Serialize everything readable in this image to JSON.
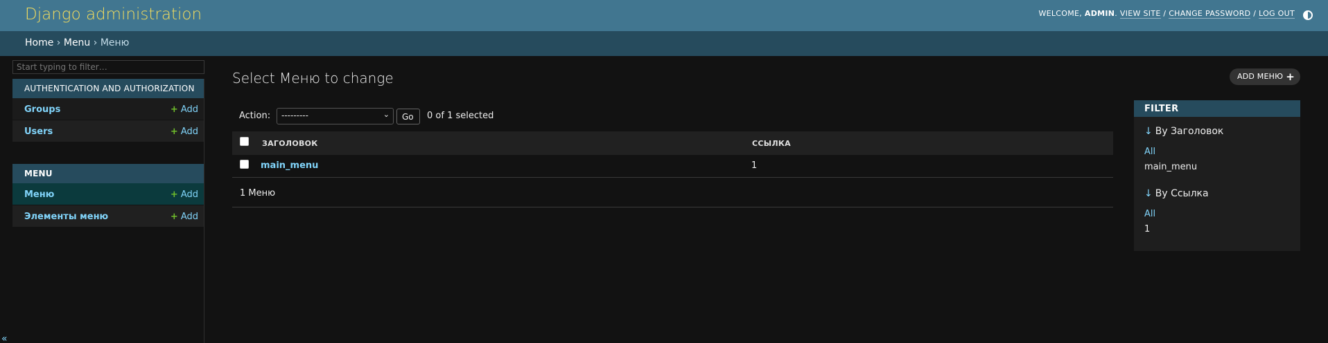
{
  "header": {
    "branding": "Django administration",
    "welcome": "Welcome,",
    "username": "admin",
    "view_site": "View site",
    "change_password": "Change password",
    "log_out": "Log out",
    "separator": "/"
  },
  "breadcrumbs": {
    "home": "Home",
    "app": "Menu",
    "model": "Меню",
    "sep": "›"
  },
  "sidebar": {
    "filter_placeholder": "Start typing to filter…",
    "modules": [
      {
        "caption": "Authentication and Authorization",
        "models": [
          {
            "name": "Groups",
            "add": "Add"
          },
          {
            "name": "Users",
            "add": "Add"
          }
        ]
      },
      {
        "caption": "Menu",
        "models": [
          {
            "name": "Меню",
            "add": "Add"
          },
          {
            "name": "Элементы меню",
            "add": "Add"
          }
        ]
      }
    ],
    "collapse": "«"
  },
  "content": {
    "title": "Select Меню to change",
    "add_button": "ADD МЕНЮ",
    "action_label": "Action:",
    "action_selected": "---------",
    "go_button": "Go",
    "action_counter": "0 of 1 selected",
    "columns": [
      "ЗАГОЛОВОК",
      "ССЫЛКА"
    ],
    "rows": [
      {
        "title": "main_menu",
        "link": "1"
      }
    ],
    "paginator": "1 Меню"
  },
  "filter": {
    "header": "FILTER",
    "groups": [
      {
        "title": "By Заголовок",
        "choices": [
          "All",
          "main_menu"
        ]
      },
      {
        "title": "By Ссылка",
        "choices": [
          "All",
          "1"
        ]
      }
    ]
  },
  "colors": {
    "header_bg": "#417690",
    "breadcrumb_bg": "#264b5d",
    "branding": "#f5dd5d",
    "link": "#81d4fa",
    "add_green": "#70bf2b",
    "body_bg": "#121212"
  },
  "icons": [
    "theme-toggle-icon",
    "plus-icon",
    "chevron-down-icon",
    "down-arrow-icon"
  ]
}
